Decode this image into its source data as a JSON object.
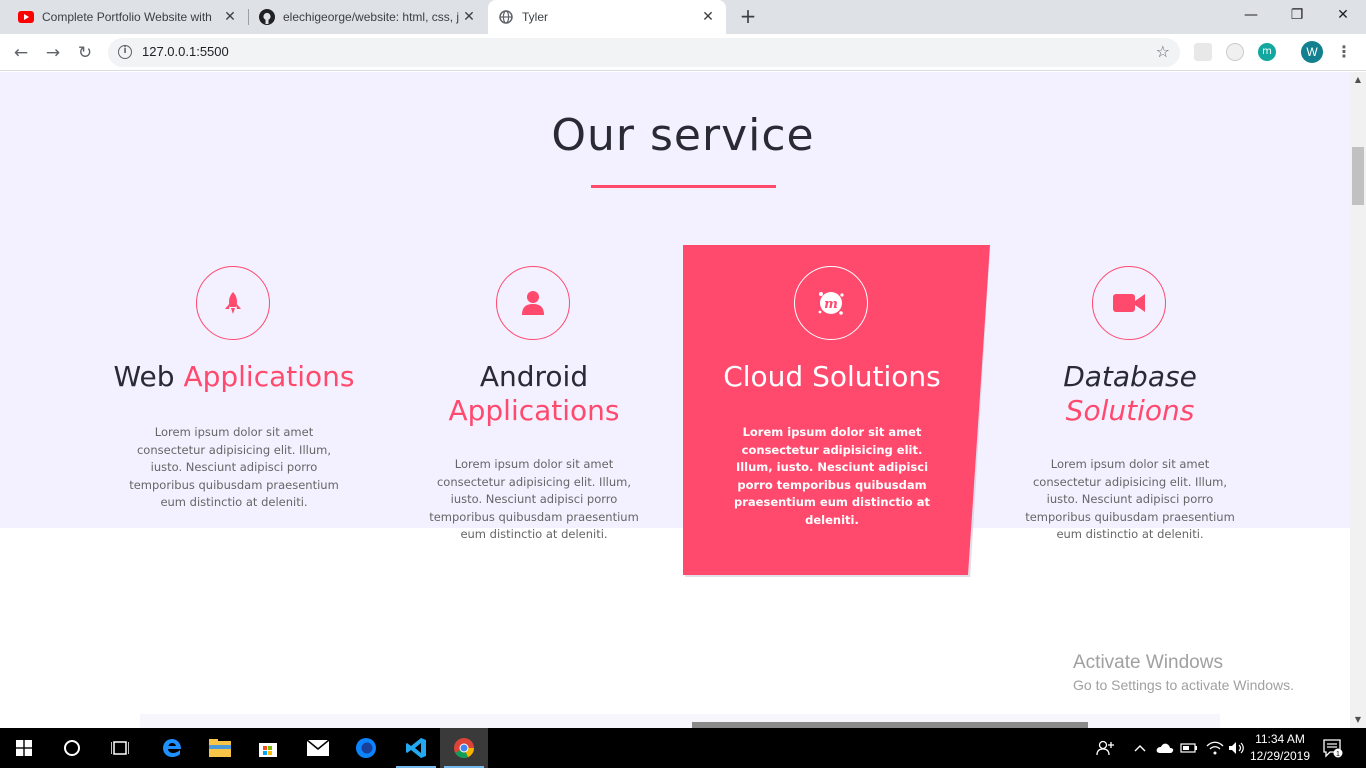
{
  "browser": {
    "tabs": [
      {
        "title": "Complete Portfolio Website with",
        "favicon": "youtube-icon",
        "active": false
      },
      {
        "title": "elechigeorge/website: html, css, j",
        "favicon": "github-icon",
        "active": false
      },
      {
        "title": "Tyler",
        "favicon": "globe-icon",
        "active": true
      }
    ],
    "url": "127.0.0.1:5500",
    "profile_initial": "W",
    "extension_initial": "m"
  },
  "page": {
    "heading": "Our service",
    "accent_color": "#ff4a6e",
    "services": [
      {
        "title_main": "Web",
        "title_accent": "Applications",
        "icon": "rocket-icon",
        "text": "Lorem ipsum dolor sit amet consectetur adipisicing elit. Illum, iusto. Nesciunt adipisci porro temporibus quibusdam praesentium eum distinctio at deleniti."
      },
      {
        "title_main": "Android",
        "title_accent": "Applications",
        "icon": "user-icon",
        "text": "Lorem ipsum dolor sit amet consectetur adipisicing elit. Illum, iusto. Nesciunt adipisci porro temporibus quibusdam praesentium eum distinctio at deleniti."
      },
      {
        "title_main": "Cloud Solutions",
        "title_accent": "",
        "icon": "meetup-icon",
        "text": "Lorem ipsum dolor sit amet consectetur adipisicing elit. Illum, iusto. Nesciunt adipisci porro temporibus quibusdam praesentium eum distinctio at deleniti."
      },
      {
        "title_main": "Database",
        "title_accent": "Solutions",
        "icon": "video-camera-icon",
        "text": "Lorem ipsum dolor sit amet consectetur adipisicing elit. Illum, iusto. Nesciunt adipisci porro temporibus quibusdam praesentium eum distinctio at deleniti."
      }
    ]
  },
  "watermark": {
    "line1": "Activate Windows",
    "line2": "Go to Settings to activate Windows."
  },
  "taskbar": {
    "time": "11:34 AM",
    "date": "12/29/2019",
    "notification_count": "1"
  }
}
